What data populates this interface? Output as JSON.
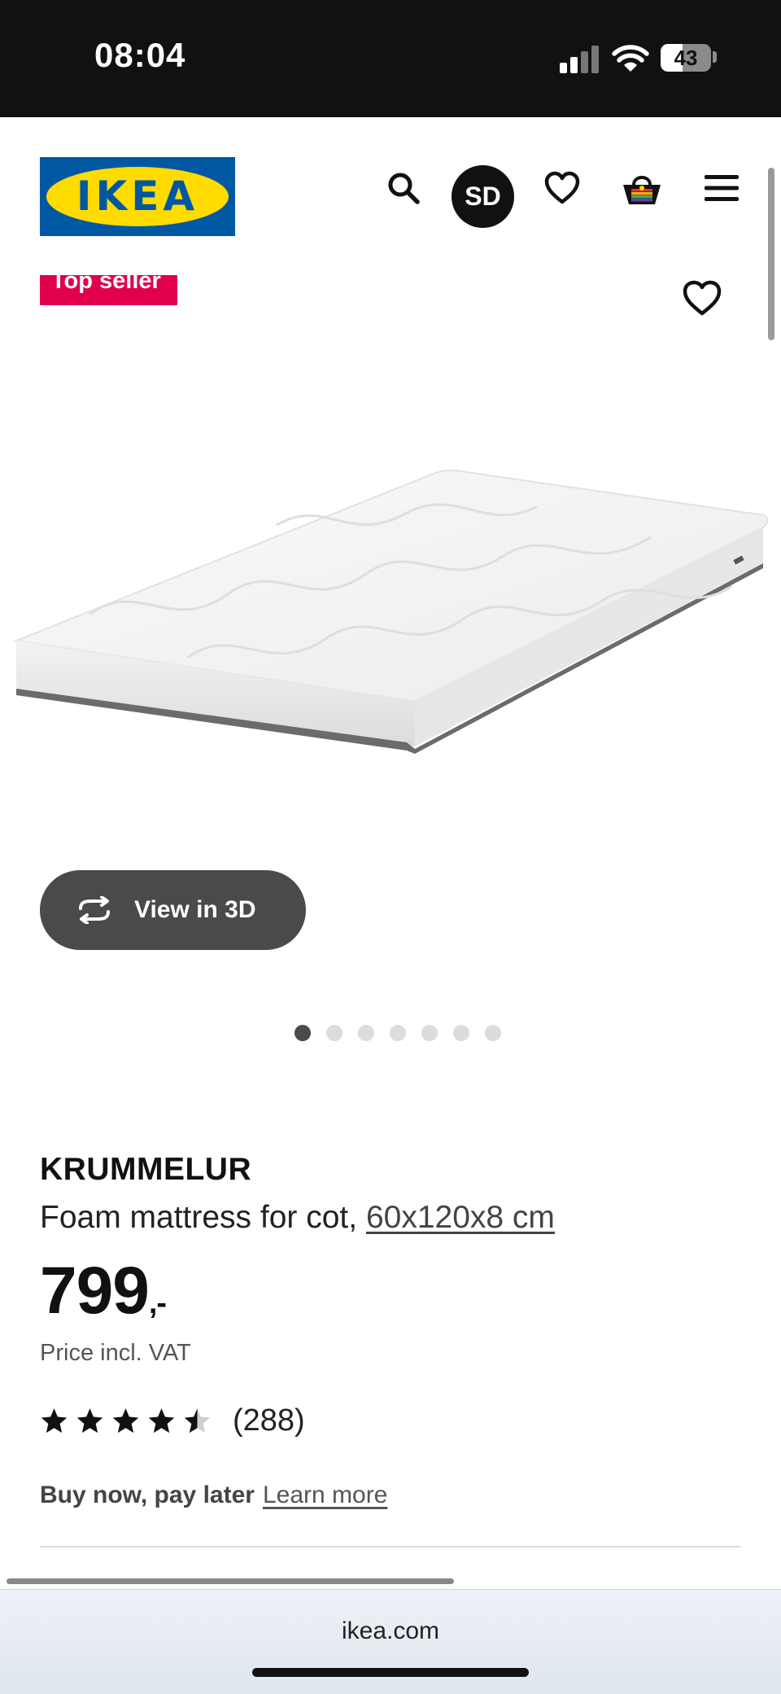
{
  "status_bar": {
    "time": "08:04",
    "battery_level": "43",
    "signal_bars_active": 2,
    "signal_bars_total": 4
  },
  "header": {
    "logo_text": "IKEA",
    "avatar_initials": "SD",
    "icons": [
      "search-icon",
      "heart-icon",
      "basket-icon",
      "menu-icon"
    ]
  },
  "product": {
    "badge": "Top seller",
    "view_3d_label": "View in 3D",
    "image_dots_total": 7,
    "image_dots_active": 0,
    "name": "KRUMMELUR",
    "description": "Foam mattress for cot,",
    "size": "60x120x8 cm",
    "price": "799",
    "price_suffix": ",-",
    "vat_note": "Price incl. VAT",
    "rating_value": 4.5,
    "rating_count": "(288)",
    "bnpl_title": "Buy now, pay later",
    "bnpl_link": "Learn more"
  },
  "browser": {
    "url": "ikea.com"
  },
  "colors": {
    "badge": "#e0004d",
    "ikea_blue": "#0058a3",
    "ikea_yellow": "#ffdb00",
    "dark_button": "#4a4a4a"
  }
}
